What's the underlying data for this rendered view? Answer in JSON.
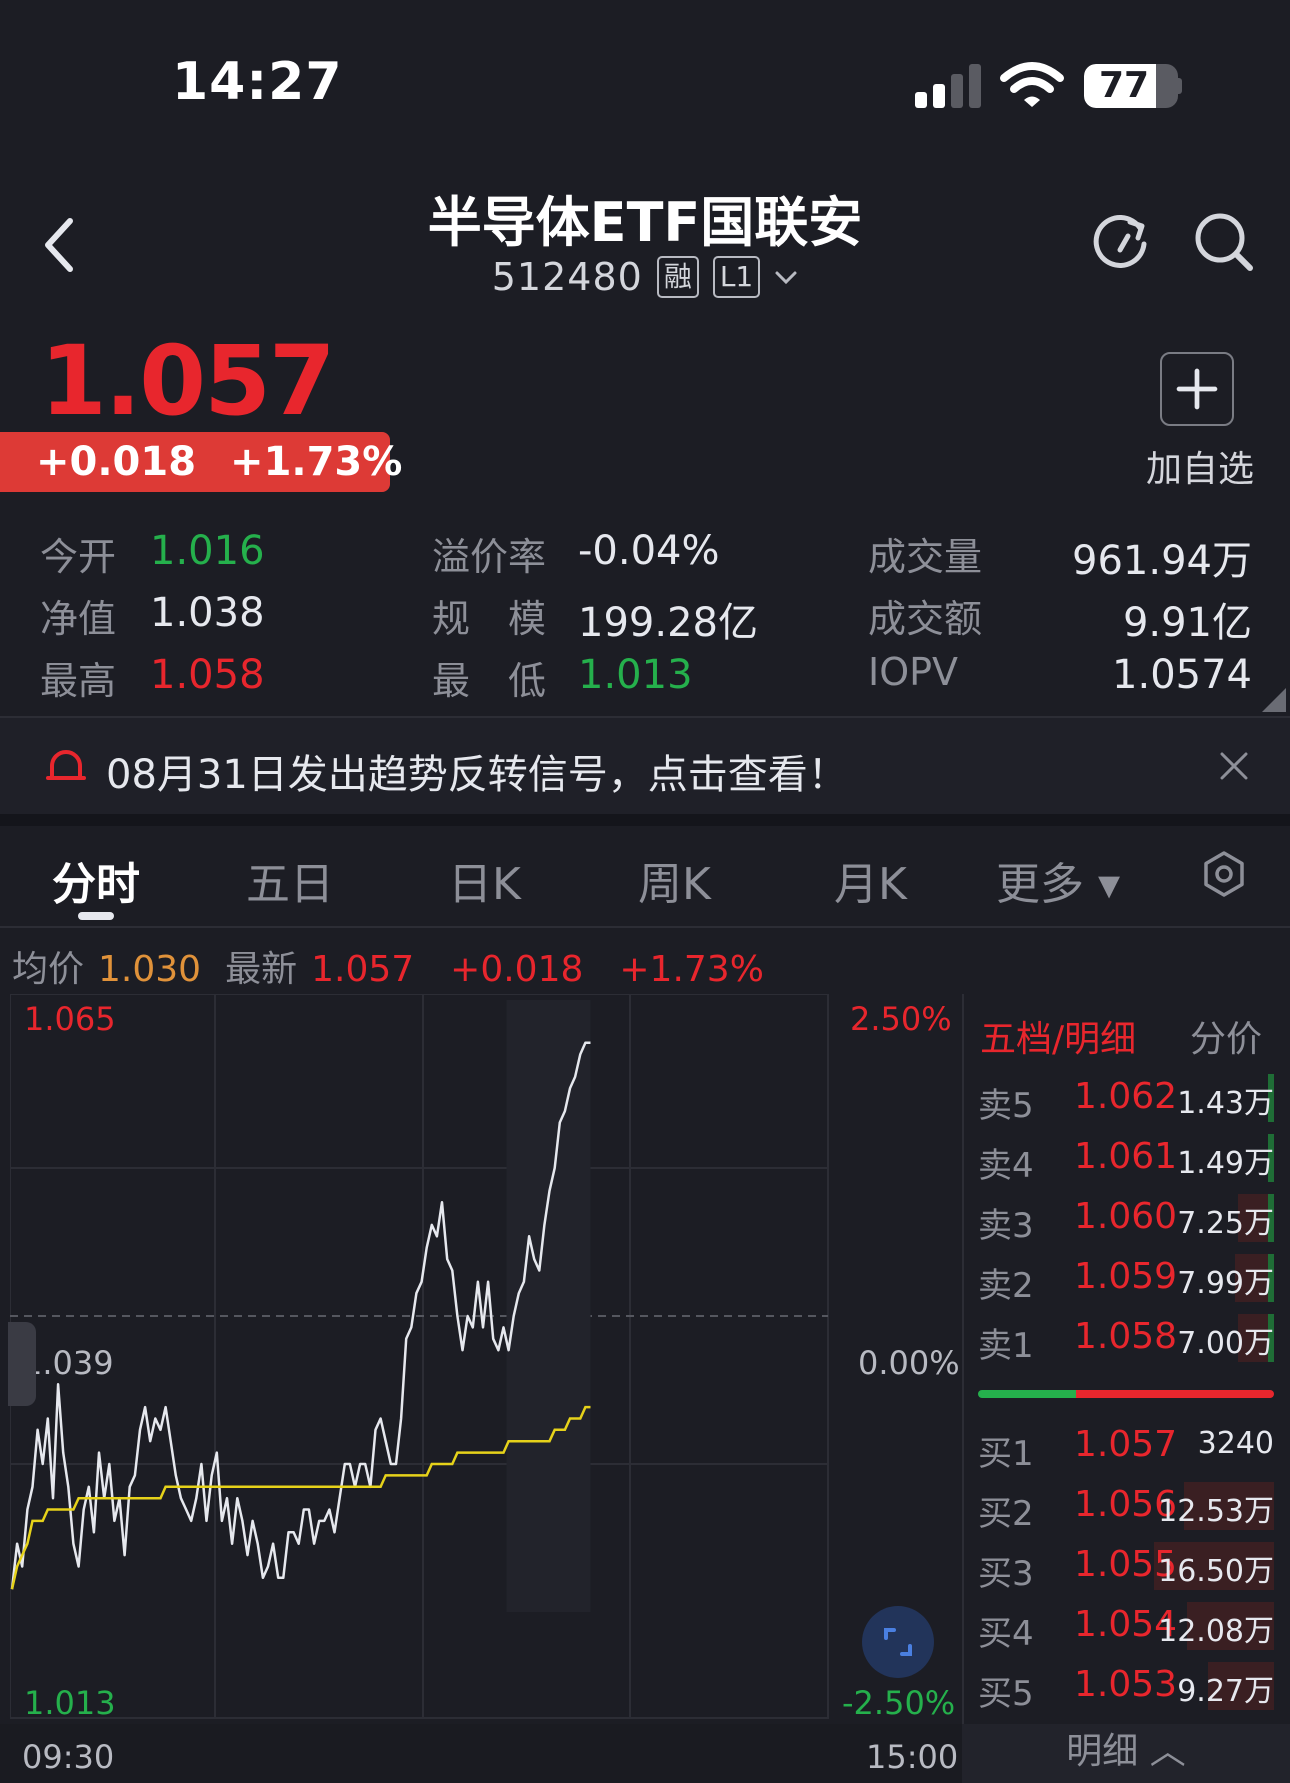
{
  "status_bar": {
    "time": "14:27",
    "battery": "77",
    "battery_level": 0.77
  },
  "header": {
    "title": "半导体ETF国联安",
    "code": "512480",
    "tags": [
      "融",
      "L1"
    ]
  },
  "quote": {
    "price": "1.057",
    "change": "+0.018",
    "change_pct": "+1.73%",
    "add_label": "加自选"
  },
  "stats": [
    {
      "label": "今开",
      "value": "1.016",
      "color": "green"
    },
    {
      "label": "溢价率",
      "value": "-0.04%",
      "color": "white"
    },
    {
      "label": "成交量",
      "value": "961.94万",
      "color": "white"
    },
    {
      "label": "净值",
      "value": "1.038",
      "color": "white"
    },
    {
      "label": "规　模",
      "value": "199.28亿",
      "color": "white"
    },
    {
      "label": "成交额",
      "value": "9.91亿",
      "color": "white"
    },
    {
      "label": "最高",
      "value": "1.058",
      "color": "red"
    },
    {
      "label": "最　低",
      "value": "1.013",
      "color": "green"
    },
    {
      "label": "IOPV",
      "value": "1.0574",
      "color": "white"
    }
  ],
  "notice": {
    "text": "08月31日发出趋势反转信号，点击查看！"
  },
  "tabs": [
    "分时",
    "五日",
    "日K",
    "周K",
    "月K",
    "更多 ▾"
  ],
  "quote_line": {
    "avg_label": "均价",
    "avg_value": "1.030",
    "latest_label": "最新",
    "latest_value": "1.057",
    "change": "+0.018",
    "change_pct": "+1.73%"
  },
  "axis": {
    "top_left": "1.065",
    "top_right": "2.50%",
    "mid_left": "1.039",
    "mid_right": "0.00%",
    "bot_left": "1.013",
    "bot_right": "-2.50%",
    "time_start": "09:30",
    "time_end": "15:00"
  },
  "chart_data": {
    "type": "line",
    "ylim": [
      1.013,
      1.065
    ],
    "series": [
      {
        "values": [
          1.015,
          1.019,
          1.017,
          1.022,
          1.024,
          1.029,
          1.026,
          1.03,
          1.023,
          1.033,
          1.027,
          1.024,
          1.019,
          1.017,
          1.022,
          1.024,
          1.02,
          1.027,
          1.023,
          1.026,
          1.021,
          1.023,
          1.018,
          1.024,
          1.025,
          1.029,
          1.031,
          1.028,
          1.03,
          1.029,
          1.031,
          1.028,
          1.025,
          1.023,
          1.022,
          1.021,
          1.023,
          1.026,
          1.021,
          1.025,
          1.027,
          1.021,
          1.023,
          1.019,
          1.023,
          1.021,
          1.018,
          1.021,
          1.019,
          1.016,
          1.017,
          1.019,
          1.016,
          1.016,
          1.02,
          1.02,
          1.019,
          1.022,
          1.022,
          1.019,
          1.021,
          1.021,
          1.022,
          1.02,
          1.023,
          1.026,
          1.026,
          1.024,
          1.026,
          1.026,
          1.024,
          1.029,
          1.03,
          1.028,
          1.026,
          1.026,
          1.03,
          1.037,
          1.038,
          1.041,
          1.042,
          1.045,
          1.047,
          1.046,
          1.049,
          1.044,
          1.043,
          1.039,
          1.036,
          1.039,
          1.038,
          1.042,
          1.038,
          1.042,
          1.037,
          1.036,
          1.038,
          1.036,
          1.039,
          1.041,
          1.042,
          1.046,
          1.044,
          1.043,
          1.047,
          1.05,
          1.052,
          1.056,
          1.057,
          1.059,
          1.06,
          1.062,
          1.063,
          1.063
        ]
      },
      {
        "values": [
          1.015,
          1.017,
          1.018,
          1.019,
          1.021,
          1.021,
          1.021,
          1.022,
          1.022,
          1.022,
          1.022,
          1.022,
          1.022,
          1.023,
          1.023,
          1.023,
          1.023,
          1.023,
          1.023,
          1.023,
          1.023,
          1.023,
          1.023,
          1.023,
          1.023,
          1.023,
          1.023,
          1.023,
          1.023,
          1.023,
          1.024,
          1.024,
          1.024,
          1.024,
          1.024,
          1.024,
          1.024,
          1.024,
          1.024,
          1.024,
          1.024,
          1.024,
          1.024,
          1.024,
          1.024,
          1.024,
          1.024,
          1.024,
          1.024,
          1.024,
          1.024,
          1.024,
          1.024,
          1.024,
          1.024,
          1.024,
          1.024,
          1.024,
          1.024,
          1.024,
          1.024,
          1.024,
          1.024,
          1.024,
          1.024,
          1.024,
          1.024,
          1.024,
          1.024,
          1.024,
          1.024,
          1.024,
          1.024,
          1.025,
          1.025,
          1.025,
          1.025,
          1.025,
          1.025,
          1.025,
          1.025,
          1.025,
          1.026,
          1.026,
          1.026,
          1.026,
          1.026,
          1.027,
          1.027,
          1.027,
          1.027,
          1.027,
          1.027,
          1.027,
          1.027,
          1.027,
          1.027,
          1.028,
          1.028,
          1.028,
          1.028,
          1.028,
          1.028,
          1.028,
          1.028,
          1.028,
          1.029,
          1.029,
          1.029,
          1.03,
          1.03,
          1.03,
          1.031,
          1.031
        ]
      }
    ]
  },
  "order_book": {
    "tab_active": "五档/明细",
    "tab_other": "分价",
    "sells": [
      {
        "label": "卖5",
        "price": "1.062",
        "volume": "1.43万",
        "bar": 0.02
      },
      {
        "label": "卖4",
        "price": "1.061",
        "volume": "1.49万",
        "bar": 0.02
      },
      {
        "label": "卖3",
        "price": "1.060",
        "volume": "7.25万",
        "bar": 0.12
      },
      {
        "label": "卖2",
        "price": "1.059",
        "volume": "7.99万",
        "bar": 0.13
      },
      {
        "label": "卖1",
        "price": "1.058",
        "volume": "7.00万",
        "bar": 0.12
      }
    ],
    "buys": [
      {
        "label": "买1",
        "price": "1.057",
        "volume": "3240",
        "bar": 0.0
      },
      {
        "label": "买2",
        "price": "1.056",
        "volume": "12.53万",
        "bar": 0.3
      },
      {
        "label": "买3",
        "price": "1.055",
        "volume": "16.50万",
        "bar": 0.4
      },
      {
        "label": "买4",
        "price": "1.054",
        "volume": "12.08万",
        "bar": 0.29
      },
      {
        "label": "买5",
        "price": "1.053",
        "volume": "9.27万",
        "bar": 0.22
      }
    ],
    "buy_sell_ratio": 0.33,
    "footer": "明细 ︿"
  },
  "colors": {
    "up": "#e8262d",
    "down": "#25b04c",
    "price_line": "#e6e8ee",
    "avg_line": "#e6d21a"
  }
}
